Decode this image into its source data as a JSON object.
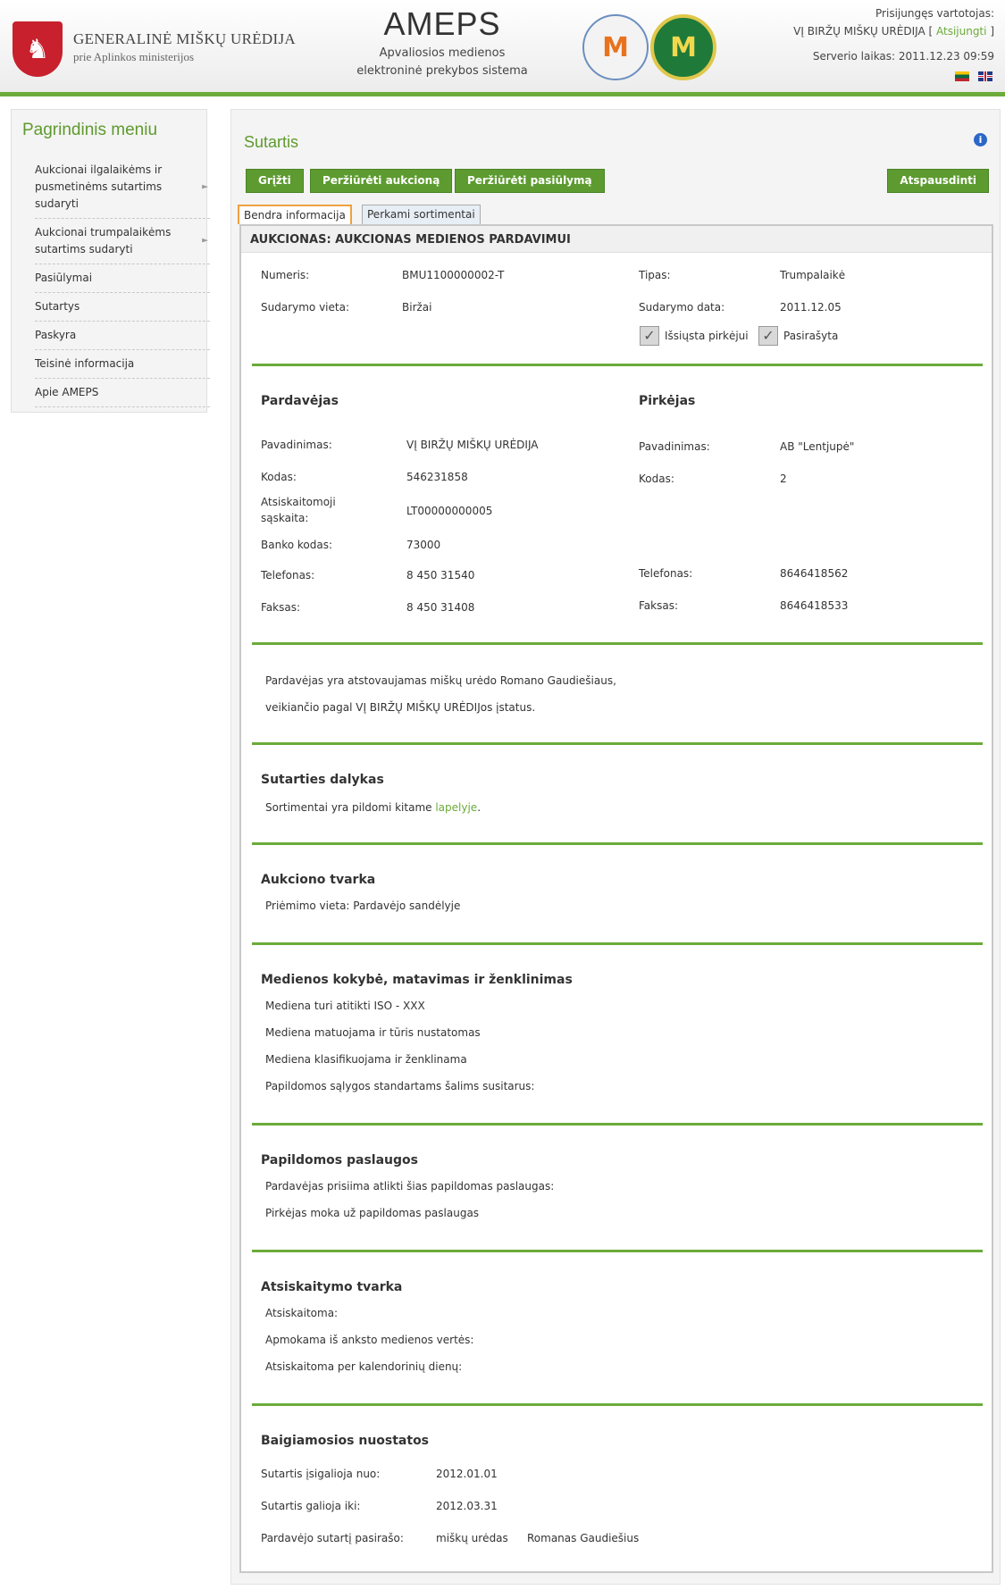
{
  "header": {
    "org_name": "GENERALINĖ MIŠKŲ URĖDIJA",
    "org_sub": "prie Aplinkos ministerijos",
    "app_title": "AMEPS",
    "app_sub_1": "Apvaliosios medienos",
    "app_sub_2": "elektroninė prekybos sistema",
    "logged_in_label": "Prisijungęs vartotojas:",
    "user_name": "VĮ BIRŽŲ MIŠKŲ URĖDIJA [",
    "logout_label": "Atsijungti",
    "user_close": "]",
    "server_time": "Serverio laikas: 2011.12.23 09:59"
  },
  "sidebar": {
    "title": "Pagrindinis meniu",
    "items": [
      {
        "label_1": "Aukcionai ilgalaikėms ir",
        "label_2": "pusmetinėms sutartims",
        "label_3": "sudaryti",
        "has_arrow": true
      },
      {
        "label_1": "Aukcionai trumpalaikėms",
        "label_2": "sutartims sudaryti",
        "has_arrow": true
      },
      {
        "label_1": "Pasiūlymai"
      },
      {
        "label_1": "Sutartys"
      },
      {
        "label_1": "Paskyra"
      },
      {
        "label_1": "Teisinė informacija"
      },
      {
        "label_1": "Apie AMEPS"
      }
    ]
  },
  "main": {
    "title": "Sutartis",
    "buttons": {
      "back": "Grįžti",
      "view_auction": "Peržiūrėti aukcioną",
      "view_offer": "Peržiūrėti pasiūlymą",
      "print": "Atspausdinti"
    },
    "tabs": {
      "general": "Bendra informacija",
      "assortments": "Perkami sortimentai"
    },
    "panel_title": "AUKCIONAS: AUKCIONAS MEDIENOS PARDAVIMUI",
    "general": {
      "number_label": "Numeris:",
      "number": "BMU1100000002-T",
      "type_label": "Tipas:",
      "type": "Trumpalaikė",
      "place_label": "Sudarymo vieta:",
      "place": "Biržai",
      "date_label": "Sudarymo data:",
      "date": "2011.12.05",
      "sent_label": "Išsiųsta pirkėjui",
      "signed_label": "Pasirašyta"
    },
    "seller": {
      "heading": "Pardavėjas",
      "name_label": "Pavadinimas:",
      "name": "VĮ BIRŽŲ MIŠKŲ URĖDIJA",
      "code_label": "Kodas:",
      "code": "546231858",
      "account_label_1": "Atsiskaitomoji",
      "account_label_2": "sąskaita:",
      "account": "LT00000000005",
      "bank_label": "Banko kodas:",
      "bank": "73000",
      "phone_label": "Telefonas:",
      "phone": "8 450 31540",
      "fax_label": "Faksas:",
      "fax": "8 450 31408"
    },
    "buyer": {
      "heading": "Pirkėjas",
      "name_label": "Pavadinimas:",
      "name": "AB \"Lentjupė\"",
      "code_label": "Kodas:",
      "code": "2",
      "phone_label": "Telefonas:",
      "phone": "8646418562",
      "fax_label": "Faksas:",
      "fax": "8646418533"
    },
    "representation": {
      "line_1": "Pardavėjas yra atstovaujamas miškų urėdo Romano Gaudiešiaus,",
      "line_2": "veikiančio pagal VĮ BIRŽŲ MIŠKŲ URĖDIJos įstatus."
    },
    "subject": {
      "heading": "Sutarties dalykas",
      "text": "Sortimentai yra pildomi kitame",
      "link": "lapelyje",
      "tail": "."
    },
    "auction_order": {
      "heading": "Aukciono tvarka",
      "text": "Priėmimo vieta: Pardavėjo sandėlyje"
    },
    "quality": {
      "heading": "Medienos kokybė, matavimas ir ženklinimas",
      "line_1": "Mediena turi atitikti ISO - XXX",
      "line_2": "Mediena matuojama ir tūris nustatomas",
      "line_3": "Mediena klasifikuojama ir ženklinama",
      "line_4": "Papildomos sąlygos standartams šalims susitarus:"
    },
    "services": {
      "heading": "Papildomos paslaugos",
      "line_1": "Pardavėjas prisiima atlikti šias papildomas paslaugas:",
      "line_2": "Pirkėjas moka už papildomas paslaugas"
    },
    "payment": {
      "heading": "Atsiskaitymo tvarka",
      "line_1": "Atsiskaitoma:",
      "line_2": "Apmokama iš anksto medienos vertės:",
      "line_3": "Atsiskaitoma per kalendorinių dienų:"
    },
    "final": {
      "heading": "Baigiamosios nuostatos",
      "valid_from_label": "Sutartis įsigalioja nuo:",
      "valid_from": "2012.01.01",
      "valid_to_label": "Sutartis galioja iki:",
      "valid_to": "2012.03.31",
      "signer_label": "Pardavėjo sutartį pasirašo:",
      "signer_role": "miškų urėdas",
      "signer_name": "Romanas Gaudiešius"
    }
  }
}
